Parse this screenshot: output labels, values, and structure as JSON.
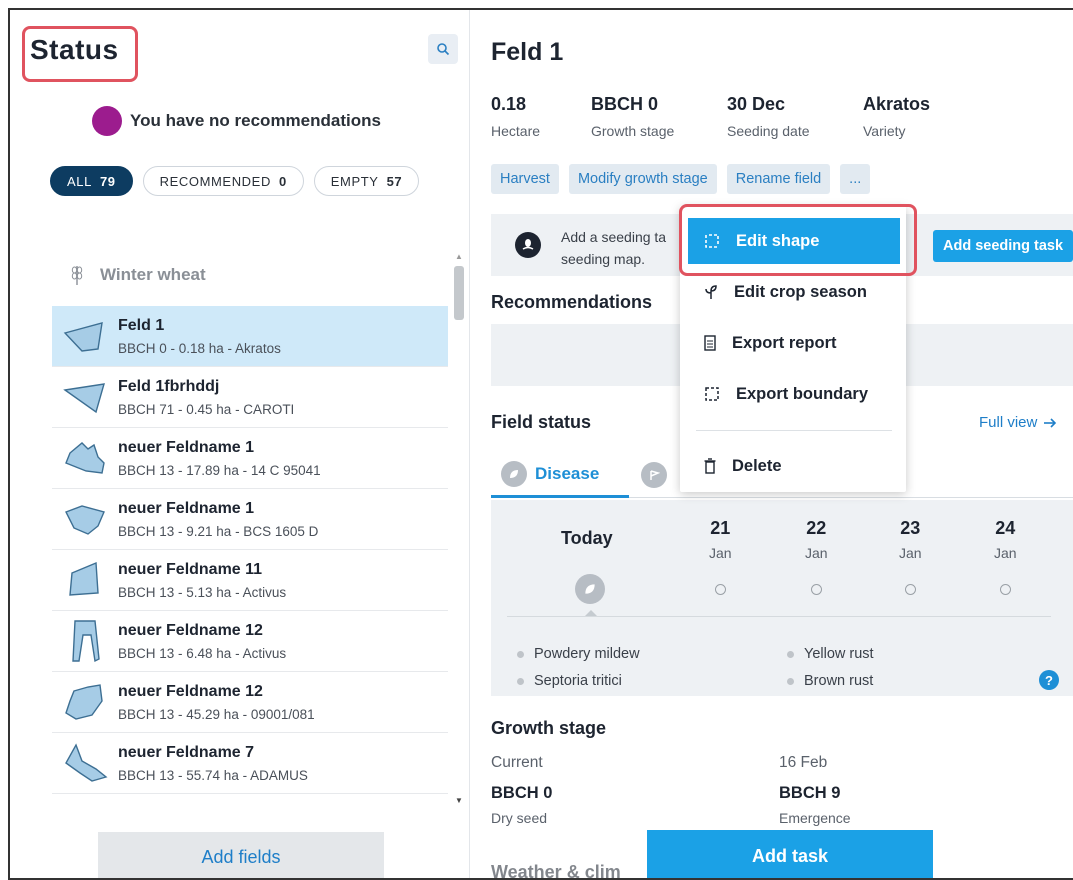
{
  "left": {
    "title": "Status",
    "recommendation_text": "You have no recommendations",
    "filters": [
      {
        "label": "ALL",
        "count": "79"
      },
      {
        "label": "RECOMMENDED",
        "count": "0"
      },
      {
        "label": "EMPTY",
        "count": "57"
      }
    ],
    "crop_group": "Winter wheat",
    "fields": [
      {
        "name": "Feld 1",
        "details": "BBCH 0 - 0.18 ha - Akratos"
      },
      {
        "name": "Feld 1fbrhddj",
        "details": "BBCH 71 - 0.45 ha - CAROTI"
      },
      {
        "name": "neuer Feldname 1",
        "details": "BBCH 13 - 17.89 ha - 14 C 95041"
      },
      {
        "name": "neuer Feldname 1",
        "details": "BBCH 13 - 9.21 ha - BCS 1605 D"
      },
      {
        "name": "neuer Feldname 11",
        "details": "BBCH 13 - 5.13 ha - Activus"
      },
      {
        "name": "neuer Feldname 12",
        "details": "BBCH 13 - 6.48 ha - Activus"
      },
      {
        "name": "neuer Feldname 12",
        "details": "BBCH 13 - 45.29 ha - 09001/081"
      },
      {
        "name": "neuer Feldname 7",
        "details": "BBCH 13 - 55.74 ha - ADAMUS"
      }
    ],
    "add_fields": "Add fields"
  },
  "right": {
    "title": "Feld 1",
    "stats": [
      {
        "value": "0.18",
        "label": "Hectare"
      },
      {
        "value": "BBCH 0",
        "label": "Growth stage"
      },
      {
        "value": "30 Dec",
        "label": "Seeding date"
      },
      {
        "value": "Akratos",
        "label": "Variety"
      }
    ],
    "actions": {
      "harvest": "Harvest",
      "modify": "Modify growth stage",
      "rename": "Rename field",
      "more": "..."
    },
    "seeding": {
      "text_line1": "Add a seeding ta",
      "text_line2": "seeding map.",
      "button": "Add seeding task"
    },
    "recommendations_title": "Recommendations",
    "field_status_title": "Field status",
    "full_view": "Full view",
    "tabs": {
      "disease": "Disease"
    },
    "forecast": {
      "today": "Today",
      "days": [
        {
          "num": "21",
          "month": "Jan"
        },
        {
          "num": "22",
          "month": "Jan"
        },
        {
          "num": "23",
          "month": "Jan"
        },
        {
          "num": "24",
          "month": "Jan"
        }
      ],
      "legend": [
        "Powdery mildew",
        "Yellow rust",
        "Septoria tritici",
        "Brown rust"
      ],
      "help": "?"
    },
    "growth": {
      "title": "Growth stage",
      "current_label": "Current",
      "current_stage": "BBCH 0",
      "current_desc": "Dry seed",
      "next_label": "16 Feb",
      "next_stage": "BBCH 9",
      "next_desc": "Emergence"
    },
    "weather_title": "Weather & clim",
    "add_task": "Add task"
  },
  "menu": {
    "items": [
      "Edit shape",
      "Edit crop season",
      "Export report",
      "Export boundary",
      "Delete"
    ]
  },
  "colors": {
    "accent": "#1ba1e6",
    "highlight": "#e0535f",
    "navy": "#0d3c61",
    "selected_row": "#cfe9f9"
  }
}
